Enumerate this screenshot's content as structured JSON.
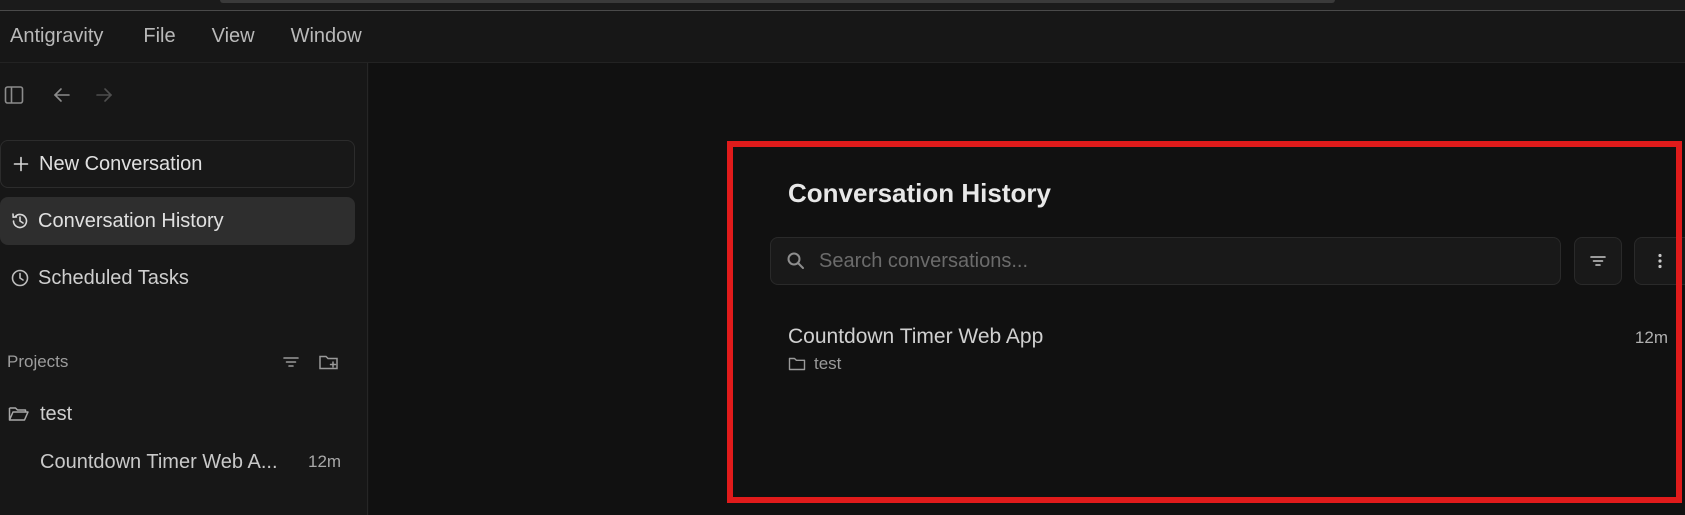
{
  "menu": [
    "Antigravity",
    "File",
    "View",
    "Window"
  ],
  "toolbar": {
    "toggle_icon": "sidebar-toggle-icon",
    "back_icon": "arrow-left-icon",
    "forward_icon": "arrow-right-icon"
  },
  "sidebar": {
    "new_conversation": "New Conversation",
    "conversation_history": "Conversation History",
    "scheduled_tasks": "Scheduled Tasks",
    "projects_label": "Projects",
    "project": {
      "name": "test",
      "conversations": [
        {
          "title": "Countdown Timer Web A...",
          "time": "12m"
        }
      ]
    }
  },
  "panel": {
    "title": "Conversation History",
    "search": {
      "placeholder": "Search conversations...",
      "value": ""
    },
    "conversations": [
      {
        "title": "Countdown Timer Web App",
        "project": "test",
        "time": "12m"
      }
    ]
  },
  "colors": {
    "background": "#111111",
    "sidebar": "#171717",
    "active_item": "#2e2e2e",
    "highlight_frame": "#e01b1b"
  }
}
